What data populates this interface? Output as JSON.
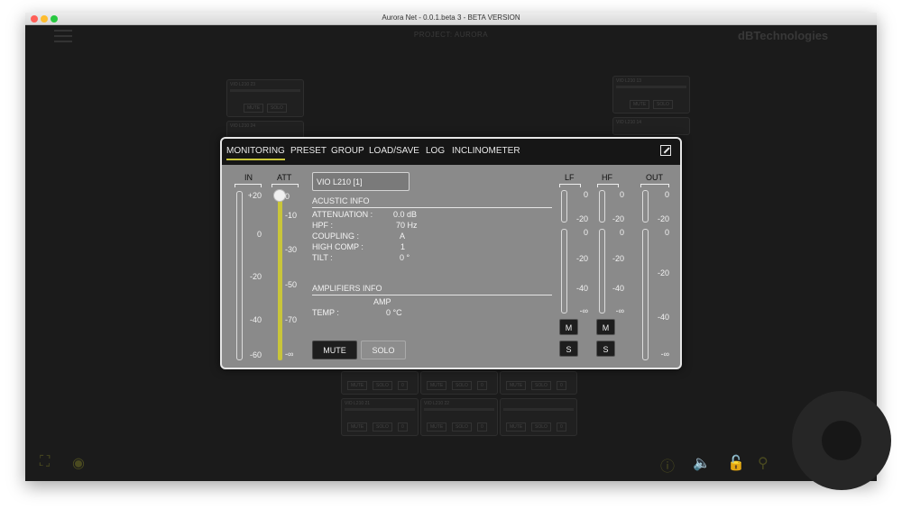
{
  "window": {
    "title": "Aurora Net - 0.0.1.beta 3 - BETA VERSION"
  },
  "appbar": {
    "project": "PROJECT: AURORA",
    "brand": "dBTechnologies"
  },
  "colors": {
    "accent": "#c9c53a",
    "modal_bg": "#8a8a8a",
    "tabbar_bg": "#161616"
  },
  "icons": {
    "menu": "hamburger-icon",
    "expand": "expand-icon",
    "fit": "fit-screen-icon",
    "view": "eye-icon",
    "info": "info-icon",
    "speaker_mute": "speaker-mute-icon",
    "lock": "lock-icon",
    "zoom": "zoom-icon",
    "pad": "joystick-pad"
  },
  "background_cards": {
    "titles": [
      "VIO L210 23",
      "VIO L210 24",
      "VIO L210 13",
      "VIO L210 14",
      "VIO L210 21",
      "VIO L210 22"
    ],
    "mute_label": "MUTE",
    "solo_label": "SOLO",
    "value_label": "0"
  },
  "modal": {
    "tabs": [
      "MONITORING",
      "PRESET",
      "GROUP",
      "LOAD/SAVE",
      "LOG",
      "INCLINOMETER"
    ],
    "active_tab": "MONITORING",
    "in_meter": {
      "header": "IN",
      "scale": [
        "+20",
        "0",
        "-20",
        "-40",
        "-60"
      ]
    },
    "att": {
      "header": "ATT",
      "value": 0,
      "scale": [
        "0",
        "-10",
        "-30",
        "-50",
        "-70",
        "-∞"
      ]
    },
    "device": "VIO L210  [1]",
    "acoustic": {
      "title": "ACUSTIC INFO",
      "rows": [
        {
          "label": "ATTENUATION :",
          "value": "0.0  dB"
        },
        {
          "label": "HPF :",
          "value": "70  Hz"
        },
        {
          "label": "COUPLING :",
          "value": "A"
        },
        {
          "label": "HIGH COMP :",
          "value": "1"
        },
        {
          "label": "TILT :",
          "value": "0  °"
        }
      ]
    },
    "amplifiers": {
      "title": "AMPLIFIERS INFO",
      "column": "AMP",
      "temp_label": "TEMP :",
      "temp_value": "0   °C"
    },
    "buttons": {
      "mute": "MUTE",
      "solo": "SOLO"
    },
    "lf": {
      "header": "LF",
      "scale_top": [
        "0",
        "-20"
      ],
      "scale_bottom": [
        "0",
        "-20",
        "-40",
        "-∞"
      ],
      "m": "M",
      "s": "S"
    },
    "hf": {
      "header": "HF",
      "scale_top": [
        "0",
        "-20"
      ],
      "scale_bottom": [
        "0",
        "-20",
        "-40",
        "-∞"
      ],
      "m": "M",
      "s": "S"
    },
    "out": {
      "header": "OUT",
      "scale": [
        "0",
        "-20",
        "0",
        "-20",
        "-40",
        "-∞"
      ]
    }
  }
}
